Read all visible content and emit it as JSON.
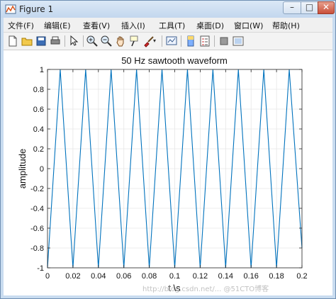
{
  "window": {
    "title": "Figure 1",
    "min_glyph": "–",
    "max_glyph": "□",
    "close_glyph": "✕"
  },
  "menu": [
    {
      "label": "文件(F)"
    },
    {
      "label": "编辑(E)"
    },
    {
      "label": "查看(V)"
    },
    {
      "label": "插入(I)"
    },
    {
      "label": "工具(T)"
    },
    {
      "label": "桌面(D)"
    },
    {
      "label": "窗口(W)"
    },
    {
      "label": "帮助(H)"
    }
  ],
  "toolbar": [
    {
      "name": "new-figure-icon"
    },
    {
      "name": "open-file-icon"
    },
    {
      "name": "save-icon"
    },
    {
      "name": "print-icon"
    },
    {
      "name": "edit-plot-arrow-icon"
    },
    {
      "name": "zoom-in-icon"
    },
    {
      "name": "zoom-out-icon"
    },
    {
      "name": "pan-hand-icon"
    },
    {
      "name": "data-cursor-icon"
    },
    {
      "name": "brush-icon"
    },
    {
      "name": "link-plot-icon"
    },
    {
      "name": "colorbar-icon"
    },
    {
      "name": "legend-icon"
    },
    {
      "name": "hide-plot-tools-icon"
    },
    {
      "name": "show-plot-tools-icon"
    }
  ],
  "chart_data": {
    "type": "line",
    "title": "50 Hz sawtooth waveform",
    "xlabel": "t \\s",
    "ylabel": "amplitude",
    "xlim": [
      0,
      0.2
    ],
    "ylim": [
      -1,
      1
    ],
    "xticks": [
      0,
      0.02,
      0.04,
      0.06,
      0.08,
      0.1,
      0.12,
      0.14,
      0.16,
      0.18,
      0.2
    ],
    "xtick_labels": [
      "0",
      "0.02",
      "0.04",
      "0.06",
      "0.08",
      "0.1",
      "0.12",
      "0.14",
      "0.16",
      "0.18",
      "0.2"
    ],
    "yticks": [
      -1,
      -0.8,
      -0.6,
      -0.4,
      -0.2,
      0,
      0.2,
      0.4,
      0.6,
      0.8,
      1
    ],
    "ytick_labels": [
      "-1",
      "-0.8",
      "-0.6",
      "-0.4",
      "-0.2",
      "0",
      "0.2",
      "0.4",
      "0.6",
      "0.8",
      "1"
    ],
    "grid": true,
    "line_color": "#0072bd",
    "series": [
      {
        "x": [
          0,
          0.01,
          0.02,
          0.03,
          0.04,
          0.05,
          0.06,
          0.07,
          0.08,
          0.09,
          0.1,
          0.11,
          0.12,
          0.13,
          0.14,
          0.15,
          0.16,
          0.17,
          0.18,
          0.19,
          0.2
        ],
        "y": [
          -1,
          1,
          -1,
          1,
          -1,
          1,
          -1,
          1,
          -1,
          1,
          -1,
          1,
          -1,
          1,
          -1,
          1,
          -1,
          1,
          -1,
          1,
          -0.8
        ]
      }
    ]
  },
  "watermark": "http://blog.csdn.net/...  @51CTO博客"
}
